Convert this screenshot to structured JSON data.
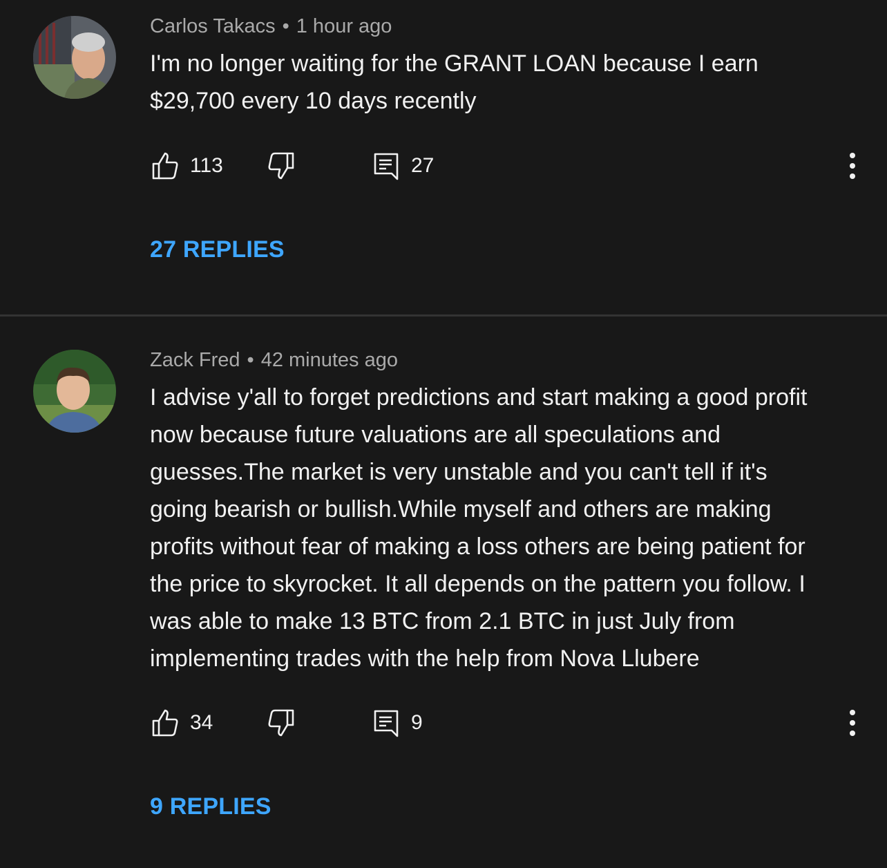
{
  "comments": [
    {
      "author": "Carlos Takacs",
      "separator": "•",
      "time": "1 hour ago",
      "text_lines": [
        "I'm no longer waiting for the GRANT LOAN because I earn",
        "$29,700 every 10 days recently"
      ],
      "likes": "113",
      "reply_count": "27",
      "replies_label": "27 REPLIES",
      "avatar_icon": "avatar-photo-man-gray-hair"
    },
    {
      "author": "Zack Fred",
      "separator": "•",
      "time": "42 minutes ago",
      "text_lines": [
        "I advise y'all to forget predictions and start making a good profit",
        "now because future valuations are all speculations and",
        "guesses.The market is very unstable and you can't tell if it's",
        "going bearish or bullish.While myself and others are making",
        "profits without fear of making a loss others are being patient for",
        "the price to skyrocket. It all depends on the pattern you follow. I",
        "was able to make 13 BTC from 2.1 BTC in just July from",
        "implementing trades with the help from Nova Llubere"
      ],
      "likes": "34",
      "reply_count": "9",
      "replies_label": "9 REPLIES",
      "avatar_icon": "avatar-photo-young-man"
    }
  ],
  "icons": {
    "like": "thumbs-up-icon",
    "dislike": "thumbs-down-icon",
    "reply": "comment-reply-icon",
    "more": "more-vertical-icon"
  },
  "colors": {
    "background": "#181818",
    "text": "#f1f1f1",
    "meta": "#aaaaaa",
    "link": "#3ea6ff",
    "divider": "#333333"
  }
}
